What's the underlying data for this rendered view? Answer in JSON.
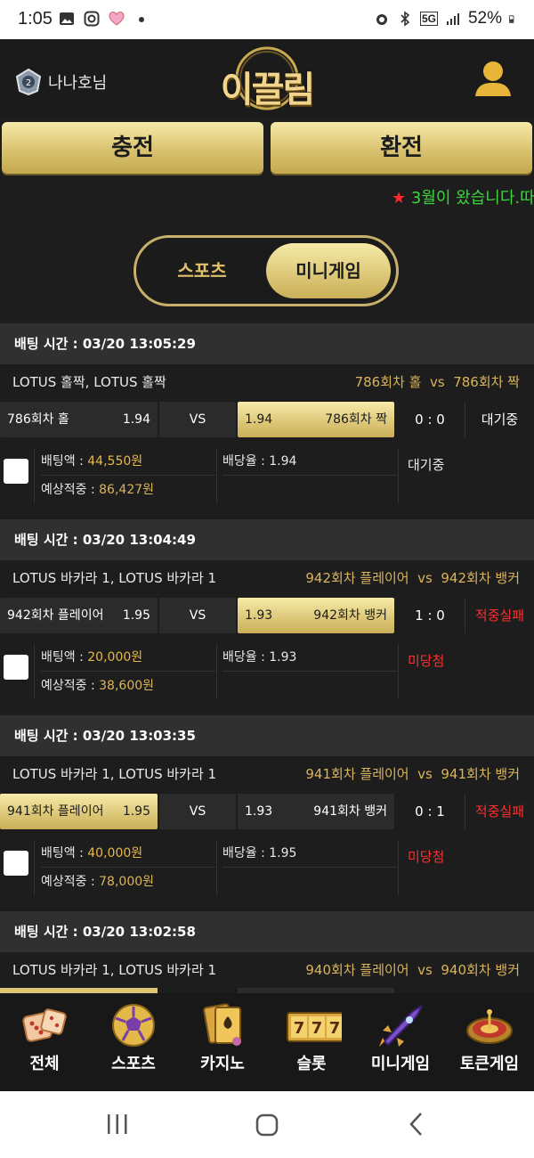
{
  "status_bar": {
    "time": "1:05",
    "battery": "52%",
    "network": "5G"
  },
  "header": {
    "username": "나나호님",
    "logo_text": "이끌림"
  },
  "buttons": {
    "charge": "충전",
    "exchange": "환전"
  },
  "notice": {
    "star": "★",
    "text": "3월이 왔습니다.따"
  },
  "tabs": {
    "sports": "스포츠",
    "minigame": "미니게임",
    "active": "minigame"
  },
  "bets": [
    {
      "time_label": "배팅 시간 : 03/20 13:05:29",
      "game": "LOTUS 홀짝, LOTUS 홀짝",
      "versus_a": "786회차 홀",
      "vs_word": "vs",
      "versus_b": "786회차 짝",
      "left_name": "786회차 홀",
      "left_odds": "1.94",
      "vs": "VS",
      "right_odds": "1.94",
      "right_name": "786회차 짝",
      "selected": "right",
      "score": "0 : 0",
      "status": "대기중",
      "status_color": "#ffffff",
      "bet_label": "배팅액 : ",
      "bet_amount": "44,550원",
      "rate_label": "배당율 : ",
      "rate": "1.94",
      "expect_label": "예상적중 : ",
      "expect_amount": "86,427원",
      "result": "대기중",
      "result_color": "#e8e8e8"
    },
    {
      "time_label": "배팅 시간 : 03/20 13:04:49",
      "game": "LOTUS 바카라 1, LOTUS 바카라 1",
      "versus_a": "942회차 플레이어",
      "vs_word": "vs",
      "versus_b": "942회차 뱅커",
      "left_name": "942회차 플레이어",
      "left_odds": "1.95",
      "vs": "VS",
      "right_odds": "1.93",
      "right_name": "942회차 뱅커",
      "selected": "right",
      "score": "1 : 0",
      "status": "적중실패",
      "status_color": "#ff2e2e",
      "bet_label": "배팅액 : ",
      "bet_amount": "20,000원",
      "rate_label": "배당율 : ",
      "rate": "1.93",
      "expect_label": "예상적중 : ",
      "expect_amount": "38,600원",
      "result": "미당첨",
      "result_color": "#ff2e2e"
    },
    {
      "time_label": "배팅 시간 : 03/20 13:03:35",
      "game": "LOTUS 바카라 1, LOTUS 바카라 1",
      "versus_a": "941회차 플레이어",
      "vs_word": "vs",
      "versus_b": "941회차 뱅커",
      "left_name": "941회차 플레이어",
      "left_odds": "1.95",
      "vs": "VS",
      "right_odds": "1.93",
      "right_name": "941회차 뱅커",
      "selected": "left",
      "score": "0 : 1",
      "status": "적중실패",
      "status_color": "#ff2e2e",
      "bet_label": "배팅액 : ",
      "bet_amount": "40,000원",
      "rate_label": "배당율 : ",
      "rate": "1.95",
      "expect_label": "예상적중 : ",
      "expect_amount": "78,000원",
      "result": "미당첨",
      "result_color": "#ff2e2e"
    },
    {
      "time_label": "배팅 시간 : 03/20 13:02:58",
      "game": "LOTUS 바카라 1, LOTUS 바카라 1",
      "versus_a": "940회차 플레이어",
      "vs_word": "vs",
      "versus_b": "940회차 뱅커"
    }
  ],
  "bottom_nav": [
    {
      "label": "전체",
      "icon": "dice-icon"
    },
    {
      "label": "스포츠",
      "icon": "soccer-ball-icon"
    },
    {
      "label": "카지노",
      "icon": "cards-icon"
    },
    {
      "label": "슬롯",
      "icon": "slot-777-icon"
    },
    {
      "label": "미니게임",
      "icon": "rocket-icon"
    },
    {
      "label": "토큰게임",
      "icon": "roulette-icon"
    }
  ],
  "colors": {
    "gold": "#dcc676",
    "accent_text": "#d9b45a",
    "amount": "#e6b84a",
    "fail": "#ff2e2e",
    "notice": "#3dd43d"
  }
}
